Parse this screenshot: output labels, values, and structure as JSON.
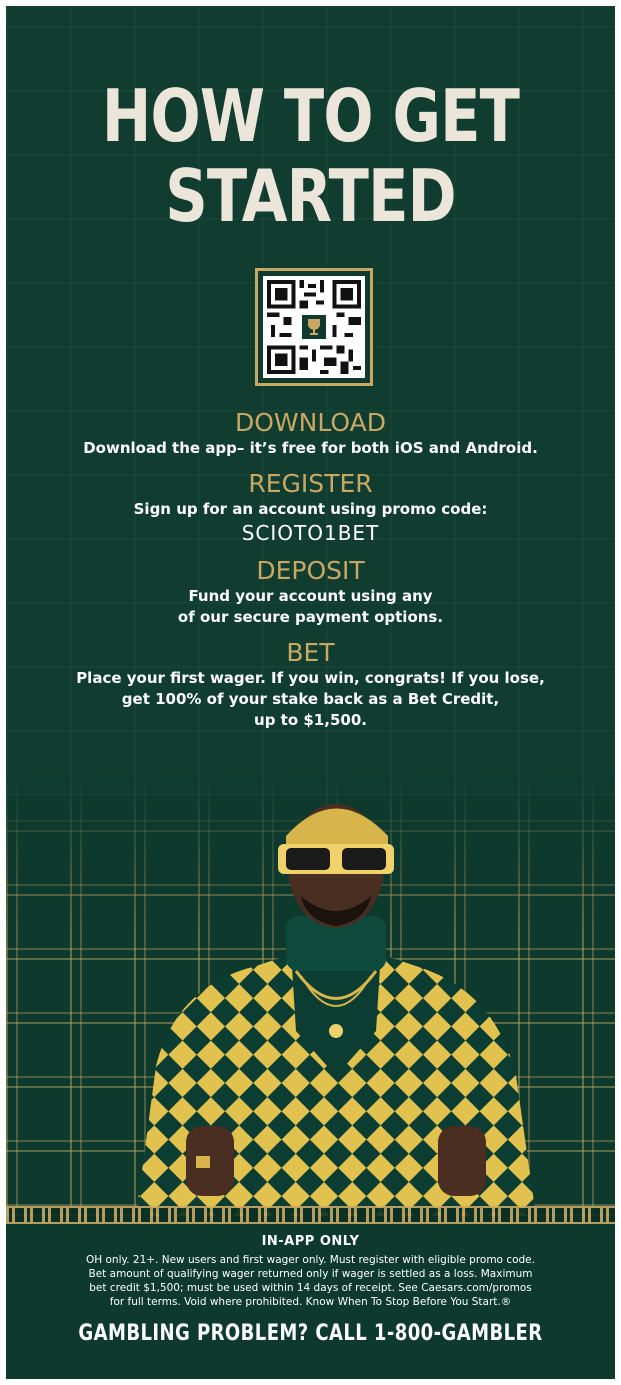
{
  "headline": {
    "line1": "HOW TO GET",
    "line2": "STARTED"
  },
  "steps": [
    {
      "title": "DOWNLOAD",
      "lines": [
        "Download the app– it’s free for both iOS and Android."
      ]
    },
    {
      "title": "REGISTER",
      "lines": [
        "Sign up for an account using promo code:"
      ],
      "promo_code": "SCIOTO1BET"
    },
    {
      "title": "DEPOSIT",
      "lines": [
        "Fund your account using any",
        "of our secure payment options."
      ]
    },
    {
      "title": "BET",
      "lines": [
        "Place your first wager. If you win, congrats! If you lose,",
        "get 100% of your stake back as a Bet Credit,",
        "up to $1,500."
      ]
    }
  ],
  "footer": {
    "in_app": "IN-APP ONLY",
    "disclaimer_lines": [
      "OH only. 21+. New users and first wager only. Must register with eligible promo code.",
      "Bet amount of qualifying wager returned only if wager is settled as a loss. Maximum",
      "bet credit $1,500; must be used within 14 days of receipt. See Caesars.com/promos",
      "for full terms. Void where prohibited. Know When To Stop Before You Start.®"
    ],
    "gambling_line": "GAMBLING PROBLEM? CALL 1-800-GAMBLER"
  },
  "colors": {
    "background": "#0f3b2e",
    "gold": "#c9a864",
    "text": "#ffffff",
    "headline": "#ebe5da"
  },
  "icons": {
    "qr": "qr-code-icon",
    "trophy": "trophy-cup-icon"
  }
}
